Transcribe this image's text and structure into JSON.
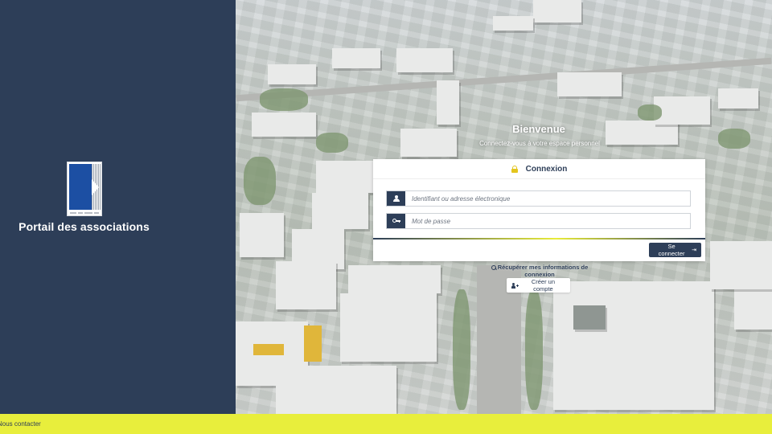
{
  "brand": {
    "portal_title": "Portail des associations",
    "primary_color": "#2d3e58",
    "accent_color": "#e8ee3c"
  },
  "welcome": {
    "title": "Bienvenue",
    "subtitle": "Connectez-vous à votre espace personnel"
  },
  "login": {
    "header": "Connexion",
    "header_icon": "lock-icon",
    "username_placeholder": "Identifiant ou adresse électronique",
    "username_icon": "user-icon",
    "password_placeholder": "Mot de passe",
    "password_icon": "key-icon",
    "submit_label": "Se connecter",
    "submit_icon": "sign-in-icon"
  },
  "links": {
    "recover": "Récupérer mes informations de connexion",
    "create_account": "Créer un compte"
  },
  "footer": {
    "contact": "Nous contacter"
  }
}
